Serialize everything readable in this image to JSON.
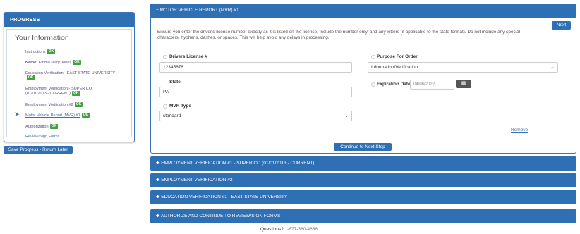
{
  "sidebar": {
    "header": "PROGRESS",
    "title": "Your Information",
    "steps": [
      {
        "label": "Instructions",
        "badge": "OK"
      },
      {
        "label_bold": "Name:",
        "label": " Emma Mary Jones",
        "badge": "OK"
      },
      {
        "label": "Education Verification - EAST STATE UNIVERSITY",
        "badge": "OK"
      },
      {
        "label": "Employment Verification - SUPER CO (01/01/2013 - CURRENT)",
        "badge": "OK"
      },
      {
        "label": "Employment Verification #2",
        "badge": "OK"
      },
      {
        "label": "Motor Vehicle Report (MVR) #1",
        "badge": "OK"
      },
      {
        "label": "Authorization",
        "badge": "OK"
      },
      {
        "label": "Review/Sign Forms"
      }
    ],
    "save_label": "Save Progress - Return Later"
  },
  "mvr": {
    "header": "− MOTOR VEHICLE REPORT (MVR) #1",
    "next_label": "Next",
    "instructions": "Ensure you enter the driver's license number exactly as it is listed on the license. Include the number only, and any letters (if applicable to the state format). Do not include any special characters, hyphens, dashes, or spaces. This will help avoid any delays in processing.",
    "license_label": "Drivers License #",
    "license_value": "12345678",
    "state_label": "State",
    "state_value": "PA",
    "mvr_type_label": "MVR Type",
    "mvr_type_value": "standard",
    "purpose_label": "Purpose For Order",
    "purpose_value": "Information/Verification",
    "expiration_label": "Expiration Date",
    "expiration_value": "04/06/2022",
    "remove_label": "Remove",
    "continue_label": "Continue to Next Step"
  },
  "sections": [
    "✚ EMPLOYMENT VERIFICATION #1   - SUPER CO  (01/01/2013 - CURRENT)",
    "✚ EMPLOYMENT VERIFICATION #2",
    "✚ EDUCATION VERIFICATION #1   - EAST STATE UNIVERSITY",
    "✚ AUTHORIZE AND CONTINUE TO REVIEW/SIGN FORMS"
  ],
  "footer": {
    "questions": "Questions?",
    "phone": " 1-877-360-4636"
  },
  "colors": {
    "accent": "#2f6fb3",
    "ok": "#44a043"
  }
}
